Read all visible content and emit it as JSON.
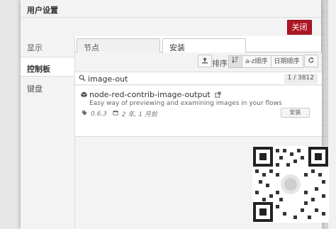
{
  "dialog": {
    "title": "用户设置",
    "close_label": "关闭"
  },
  "nav": {
    "items": [
      {
        "label": "显示",
        "active": false
      },
      {
        "label": "控制板",
        "active": true
      },
      {
        "label": "键盘",
        "active": false
      }
    ]
  },
  "tabs": [
    {
      "label": "节点",
      "active": false
    },
    {
      "label": "安装",
      "active": true
    }
  ],
  "sort": {
    "label": "排序:",
    "options": [
      "a-z顺序",
      "日期顺序"
    ]
  },
  "search": {
    "value": "image-out",
    "count": "1 / 3812"
  },
  "result": {
    "name": "node-red-contrib-image-output",
    "description": "Easy way of previewing and examining images in your flows",
    "version": "0.6.3",
    "updated": "2 年, 1 月前",
    "install_label": "安装"
  },
  "icons": {
    "upload": "upload-icon",
    "sort": "sort-icon",
    "refresh": "refresh-icon",
    "search": "search-icon",
    "package": "package-icon",
    "external_link": "external-link-icon",
    "tag": "tag-icon",
    "calendar": "calendar-icon"
  },
  "colors": {
    "close_button": "#ad1625"
  }
}
